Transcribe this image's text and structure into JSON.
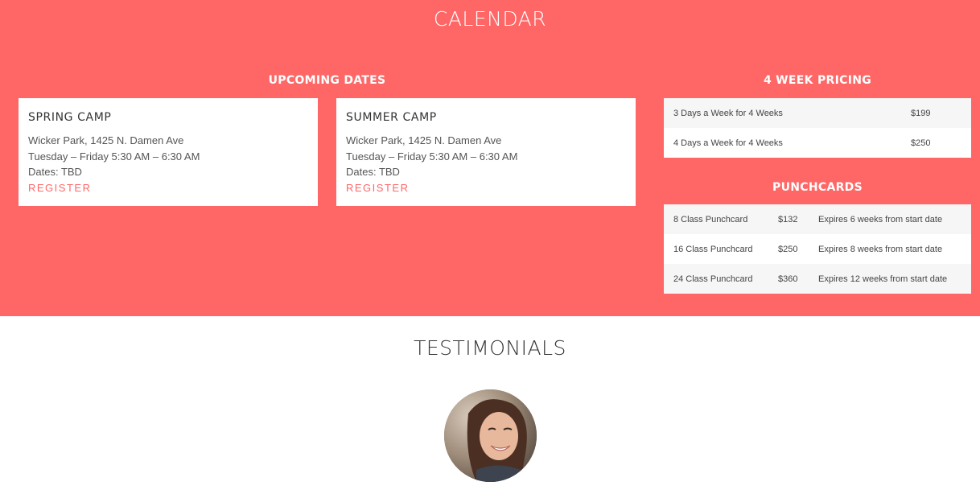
{
  "calendar": {
    "title": "CALENDAR",
    "upcoming_heading": "UPCOMING DATES",
    "camps": [
      {
        "name": "SPRING CAMP",
        "location": "Wicker Park, 1425 N. Damen Ave",
        "schedule": "Tuesday – Friday 5:30 AM – 6:30 AM",
        "dates": "Dates: TBD",
        "register_label": "REGISTER"
      },
      {
        "name": "SUMMER CAMP",
        "location": "Wicker Park, 1425 N. Damen Ave",
        "schedule": "Tuesday – Friday 5:30 AM – 6:30 AM",
        "dates": "Dates: TBD",
        "register_label": "REGISTER"
      }
    ],
    "pricing": {
      "heading": "4 WEEK PRICING",
      "rows": [
        {
          "plan": "3 Days a Week for 4 Weeks",
          "price": "$199"
        },
        {
          "plan": "4 Days a Week for 4 Weeks",
          "price": "$250"
        }
      ]
    },
    "punchcards": {
      "heading": "PUNCHCARDS",
      "rows": [
        {
          "name": "8 Class Punchcard",
          "price": "$132",
          "expiry": "Expires 6 weeks from start date"
        },
        {
          "name": "16 Class Punchcard",
          "price": "$250",
          "expiry": "Expires 8 weeks from start date"
        },
        {
          "name": "24 Class Punchcard",
          "price": "$360",
          "expiry": "Expires 12 weeks from start date"
        }
      ]
    }
  },
  "testimonials": {
    "title": "TESTIMONIALS"
  },
  "colors": {
    "accent": "#ff6767",
    "card_background": "#ffffff",
    "row_alt": "#f6f6f6"
  }
}
